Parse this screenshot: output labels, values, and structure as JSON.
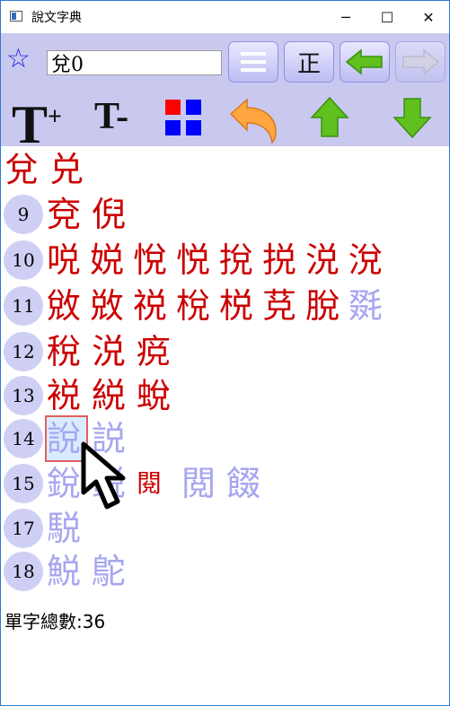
{
  "window": {
    "title": "說文字典",
    "minimize": "─",
    "maximize": "☐",
    "close": "✕"
  },
  "toolbar": {
    "search_value": "兌0",
    "star_icon": "star-outline-icon",
    "menu_icon": "hamburger-icon",
    "zheng_label": "正",
    "back_icon": "arrow-left-icon",
    "forward_icon": "arrow-right-icon",
    "font_bigger": "T",
    "font_bigger_sign": "+",
    "font_smaller": "T-",
    "undo_icon": "undo-icon",
    "up_icon": "arrow-up-icon",
    "down_icon": "arrow-down-icon"
  },
  "colors": {
    "accent": "#cc0000",
    "muted": "#a6a6f0",
    "toolbar_bg": "#c9c9f0"
  },
  "head_chars": [
    "兌",
    "兑"
  ],
  "rows": [
    {
      "num": "9",
      "chars": [
        "兗",
        "倪"
      ]
    },
    {
      "num": "10",
      "chars": [
        "哾",
        "娧",
        "悅",
        "悦",
        "挩",
        "捝",
        "涚",
        "涗"
      ]
    },
    {
      "num": "11",
      "chars": [
        "敓",
        "敚",
        "祱",
        "梲",
        "棁",
        "莌",
        "脫",
        "毲"
      ]
    },
    {
      "num": "12",
      "chars": [
        "稅",
        "涚",
        "痥"
      ]
    },
    {
      "num": "13",
      "chars": [
        "裞",
        "綐",
        "蛻"
      ]
    },
    {
      "num": "14",
      "chars": [
        "說",
        "説"
      ]
    },
    {
      "num": "15",
      "chars": [
        "銳",
        "鋭",
        "閱",
        "閲",
        "餟"
      ]
    },
    {
      "num": "17",
      "chars": [
        "駾"
      ]
    },
    {
      "num": "18",
      "chars": [
        "鮵",
        "鴕"
      ]
    }
  ],
  "status": {
    "count_label": "單字總數:36"
  }
}
